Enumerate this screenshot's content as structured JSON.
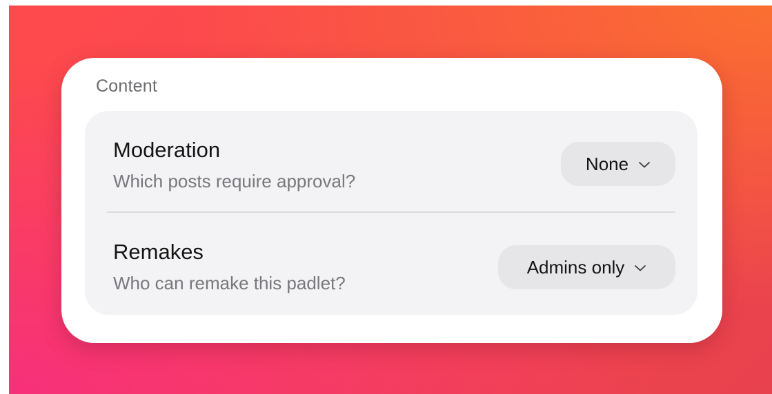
{
  "section": {
    "title": "Content"
  },
  "settings": [
    {
      "title": "Moderation",
      "description": "Which posts require approval?",
      "value": "None"
    },
    {
      "title": "Remakes",
      "description": "Who can remake this padlet?",
      "value": "Admins only"
    }
  ],
  "icons": {
    "dropdown": "chevron-down-icon"
  },
  "colors": {
    "background_gradient": [
      "#f7307a",
      "#ff4a4d",
      "#fb6f30"
    ],
    "card": "#ffffff",
    "panel": "#f3f3f5",
    "select_bg": "#e6e6e9"
  }
}
